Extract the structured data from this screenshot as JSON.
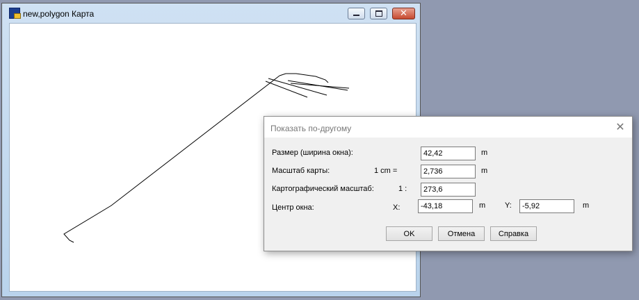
{
  "window": {
    "title": "new,polygon Карта",
    "icon": "map-app-icon",
    "controls": {
      "minimize": "minimize-icon",
      "maximize": "maximize-icon",
      "close": "close-icon"
    }
  },
  "dialog": {
    "title": "Показать по-другому",
    "close_glyph": "✕",
    "rows": {
      "size_label": "Размер (ширина окна):",
      "size_value": "42,42",
      "size_unit": "m",
      "scale_label": "Масштаб карты:",
      "scale_prefix": "1 cm =",
      "scale_value": "2,736",
      "scale_unit": "m",
      "carto_label": "Картографический масштаб:",
      "carto_prefix": "1 :",
      "carto_value": "273,6",
      "center_label": "Центр окна:",
      "x_label": "X:",
      "x_value": "-43,18",
      "x_unit": "m",
      "y_label": "Y:",
      "y_value": "-5,92",
      "y_unit": "m"
    },
    "buttons": {
      "ok": "OK",
      "cancel": "Отмена",
      "help": "Справка"
    }
  },
  "colors": {
    "desktop": "#9099b0",
    "window_frame": "#c4d9ef",
    "close_button": "#c74a30",
    "dialog_bg": "#f0f0f0"
  }
}
